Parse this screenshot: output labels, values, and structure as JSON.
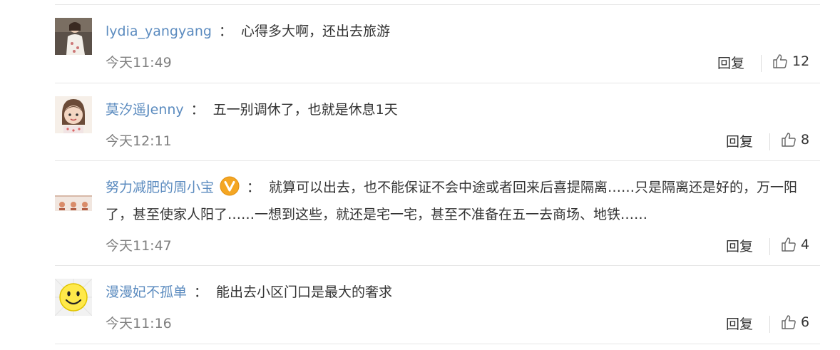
{
  "comments": [
    {
      "username": "lydia_yangyang",
      "verified": false,
      "text": "心得多大啊，还出去旅游",
      "time": "今天11:49",
      "reply_label": "回复",
      "likes": "12"
    },
    {
      "username": "莫汐遥Jenny",
      "verified": false,
      "text": "五一别调休了，也就是休息1天",
      "time": "今天12:11",
      "reply_label": "回复",
      "likes": "8"
    },
    {
      "username": "努力减肥的周小宝",
      "verified": true,
      "text": "就算可以出去，也不能保证不会中途或者回来后喜提隔离……只是隔离还是好的，万一阳了，甚至使家人阳了……一想到这些，就还是宅一宅，甚至不准备在五一去商场、地铁……",
      "time": "今天11:47",
      "reply_label": "回复",
      "likes": "4"
    },
    {
      "username": "漫漫妃不孤单",
      "verified": false,
      "text": "能出去小区门口是最大的奢求",
      "time": "今天11:16",
      "reply_label": "回复",
      "likes": "6"
    }
  ],
  "colon": "：",
  "colors": {
    "username": "#5b8bbf",
    "time": "#808080",
    "divider": "#e6e6e6",
    "verified_badge": "#f4a623"
  }
}
